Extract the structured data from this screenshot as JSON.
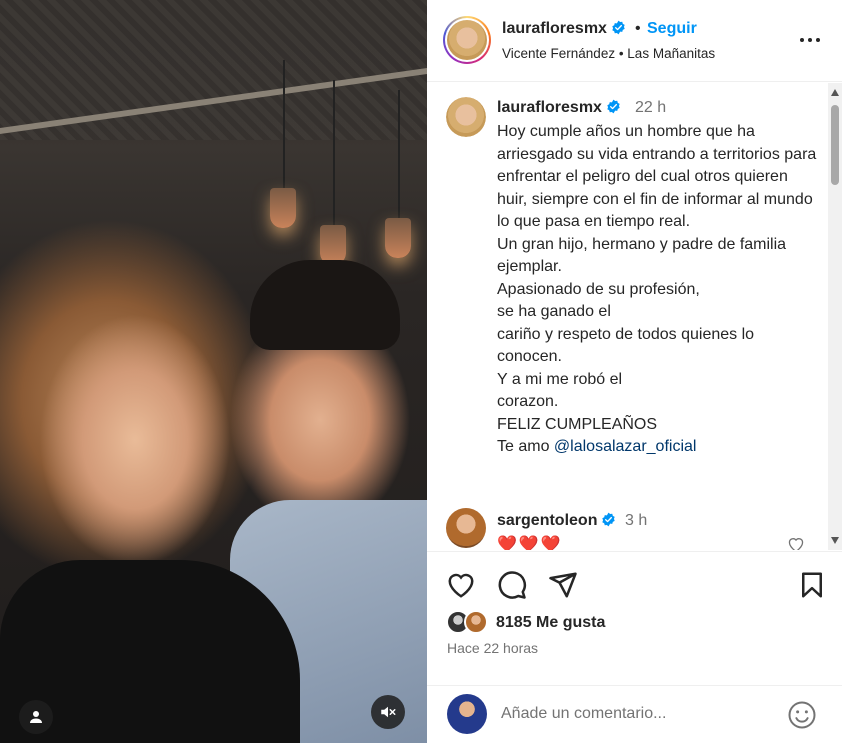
{
  "header": {
    "username": "laurafloresmx",
    "separator": "•",
    "follow_label": "Seguir",
    "audio": "Vicente Fernández • Las Mañanitas"
  },
  "caption": {
    "username": "laurafloresmx",
    "time": "22 h",
    "text_before_mention": "Hoy cumple años un hombre que ha arriesgado su vida entrando a territorios para enfrentar el peligro del cual otros quieren huir, siempre con el fin de informar al mundo lo que pasa en tiempo real.\nUn gran hijo, hermano y padre de familia ejemplar.\nApasionado de su profesión,\nse ha ganado el\ncariño y respeto de todos quienes lo conocen.\nY a mi me robó el\ncorazon.\nFELIZ CUMPLEAÑOS\nTe amo ",
    "mention": "@lalosalazar_oficial"
  },
  "comment": {
    "username": "sargentoleon",
    "time": "3 h",
    "text": "❤️❤️❤️"
  },
  "actions": {
    "likes": "8185 Me gusta",
    "time_ago": "Hace 22 horas"
  },
  "comment_input": {
    "placeholder": "Añade un comentario..."
  },
  "colors": {
    "accent": "#0095f6",
    "verified": "#0095f6",
    "text": "#262626",
    "secondary": "#737373",
    "mention": "#00376b"
  },
  "icons": [
    "verified-icon",
    "more-options-icon",
    "heart-icon",
    "comment-icon",
    "share-icon",
    "bookmark-icon",
    "emoji-icon",
    "user-tag-icon",
    "mute-icon"
  ]
}
